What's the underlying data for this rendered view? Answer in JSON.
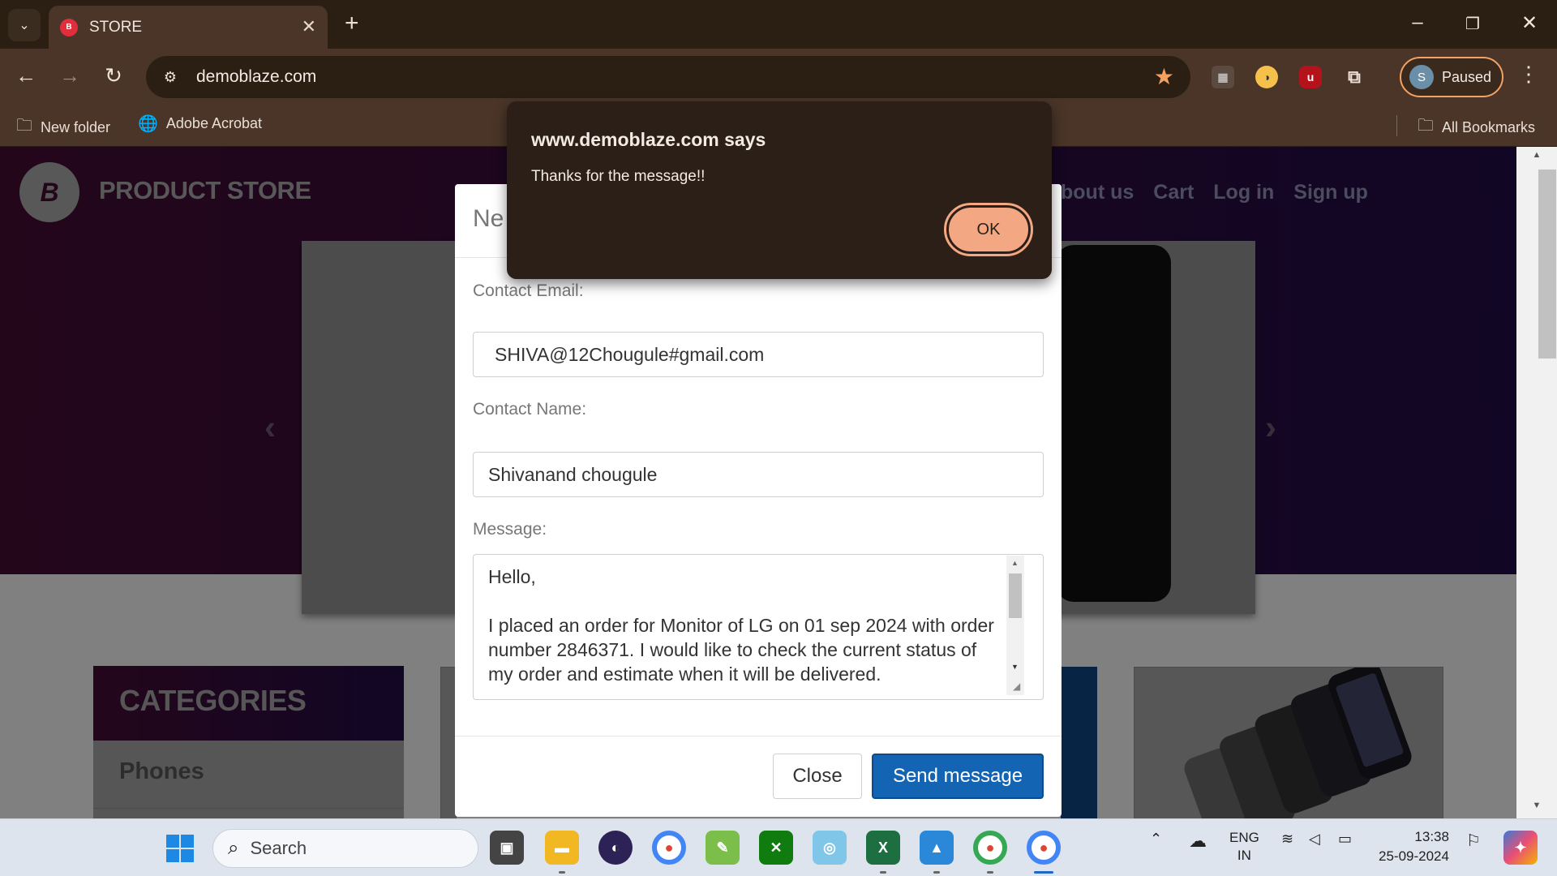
{
  "browser": {
    "tab_title": "STORE",
    "url": "demoblaze.com",
    "bookmarks": [
      "New folder",
      "Adobe Acrobat"
    ],
    "all_bookmarks": "All Bookmarks",
    "profile_status": "Paused",
    "profile_initial": "S"
  },
  "site": {
    "brand": "PRODUCT STORE",
    "logo_letter": "B",
    "nav": [
      "bout us",
      "Cart",
      "Log in",
      "Sign up"
    ],
    "categories_heading": "CATEGORIES",
    "categories": [
      "Phones"
    ]
  },
  "modal": {
    "title_partial": "Ne",
    "email_label": "Contact Email:",
    "email_value": "SHIVA@12Chougule#gmail.com",
    "name_label": "Contact Name:",
    "name_value": "Shivanand chougule",
    "message_label": "Message:",
    "message_line1": "Hello,",
    "message_line2": "I placed an order for Monitor of LG on 01 sep 2024 with order number 2846371. I would like to check the current status of my order and estimate when it will be delivered.",
    "close_label": "Close",
    "send_label": "Send message"
  },
  "alert": {
    "title": "www.demoblaze.com says",
    "message": "Thanks for the message!!",
    "ok_label": "OK"
  },
  "taskbar": {
    "search_placeholder": "Search",
    "lang_top": "ENG",
    "lang_bottom": "IN",
    "time": "13:38",
    "date": "25-09-2024"
  }
}
